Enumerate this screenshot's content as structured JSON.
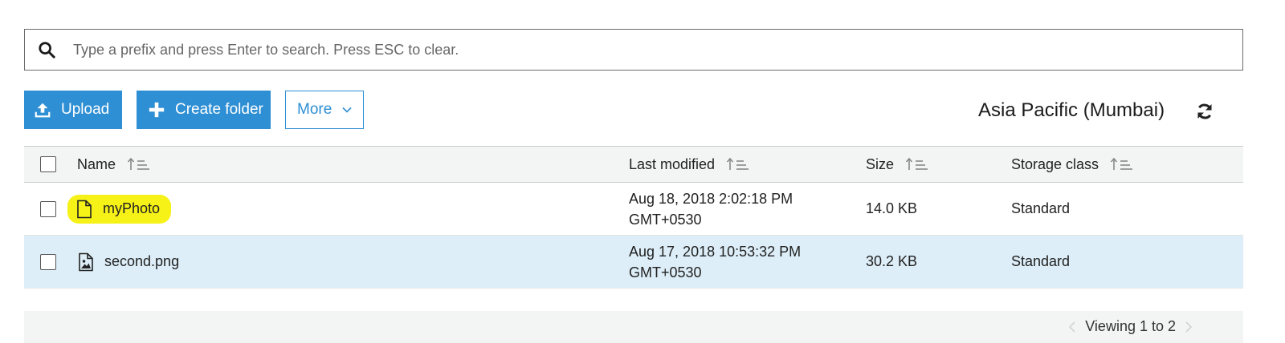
{
  "search": {
    "placeholder": "Type a prefix and press Enter to search. Press ESC to clear.",
    "icon": "search-icon"
  },
  "toolbar": {
    "upload_label": "Upload",
    "create_folder_label": "Create folder",
    "more_label": "More",
    "primary_color": "#2e8fd4"
  },
  "region": {
    "label": "Asia Pacific (Mumbai)"
  },
  "table": {
    "columns": {
      "name": "Name",
      "last_modified": "Last modified",
      "size": "Size",
      "storage_class": "Storage class"
    },
    "rows": [
      {
        "name": "myPhoto",
        "icon": "file-icon",
        "modified_line1": "Aug 18, 2018 2:02:18 PM",
        "modified_line2": "GMT+0530",
        "size": "14.0 KB",
        "storage_class": "Standard",
        "highlighted": true,
        "highlight_color": "#f6f117"
      },
      {
        "name": "second.png",
        "icon": "image-file-icon",
        "modified_line1": "Aug 17, 2018 10:53:32 PM",
        "modified_line2": "GMT+0530",
        "size": "30.2 KB",
        "storage_class": "Standard",
        "selected_row_color": "#ddeef8"
      }
    ]
  },
  "footer": {
    "viewing_text": "Viewing 1 to 2"
  }
}
